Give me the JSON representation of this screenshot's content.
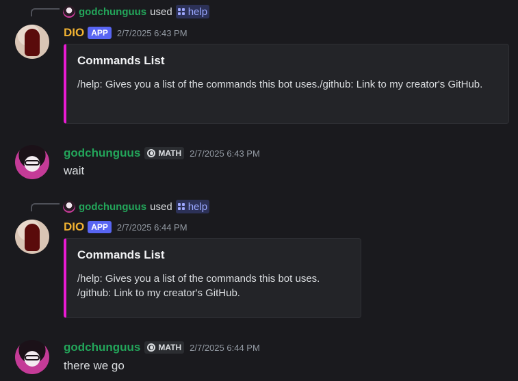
{
  "messages": [
    {
      "reply": {
        "user": "godchunguus",
        "used": "used",
        "command": "help"
      },
      "author": "DIO",
      "badge": "APP",
      "time": "2/7/2025 6:43 PM",
      "embed": {
        "title": "Commands List",
        "description": "/help: Gives you a list of the commands this bot uses./github: Link to my creator's GitHub."
      }
    },
    {
      "author": "godchunguus",
      "tag": "MATH",
      "time": "2/7/2025 6:43 PM",
      "text": "wait"
    },
    {
      "reply": {
        "user": "godchunguus",
        "used": "used",
        "command": "help"
      },
      "author": "DIO",
      "badge": "APP",
      "time": "2/7/2025 6:44 PM",
      "embed": {
        "title": "Commands List",
        "description": "/help: Gives you a list of the commands this bot uses.\n/github: Link to my creator's GitHub."
      }
    },
    {
      "author": "godchunguus",
      "tag": "MATH",
      "time": "2/7/2025 6:44 PM",
      "text": "there we go"
    }
  ],
  "colors": {
    "background": "#1a1a1e",
    "bot_name": "#f0b232",
    "user_name": "#23a55a",
    "app_badge": "#5865f2",
    "embed_accent": "#e91bd3"
  },
  "icons": {
    "command": "slash-command-icon",
    "tag": "guild-tag-icon"
  }
}
